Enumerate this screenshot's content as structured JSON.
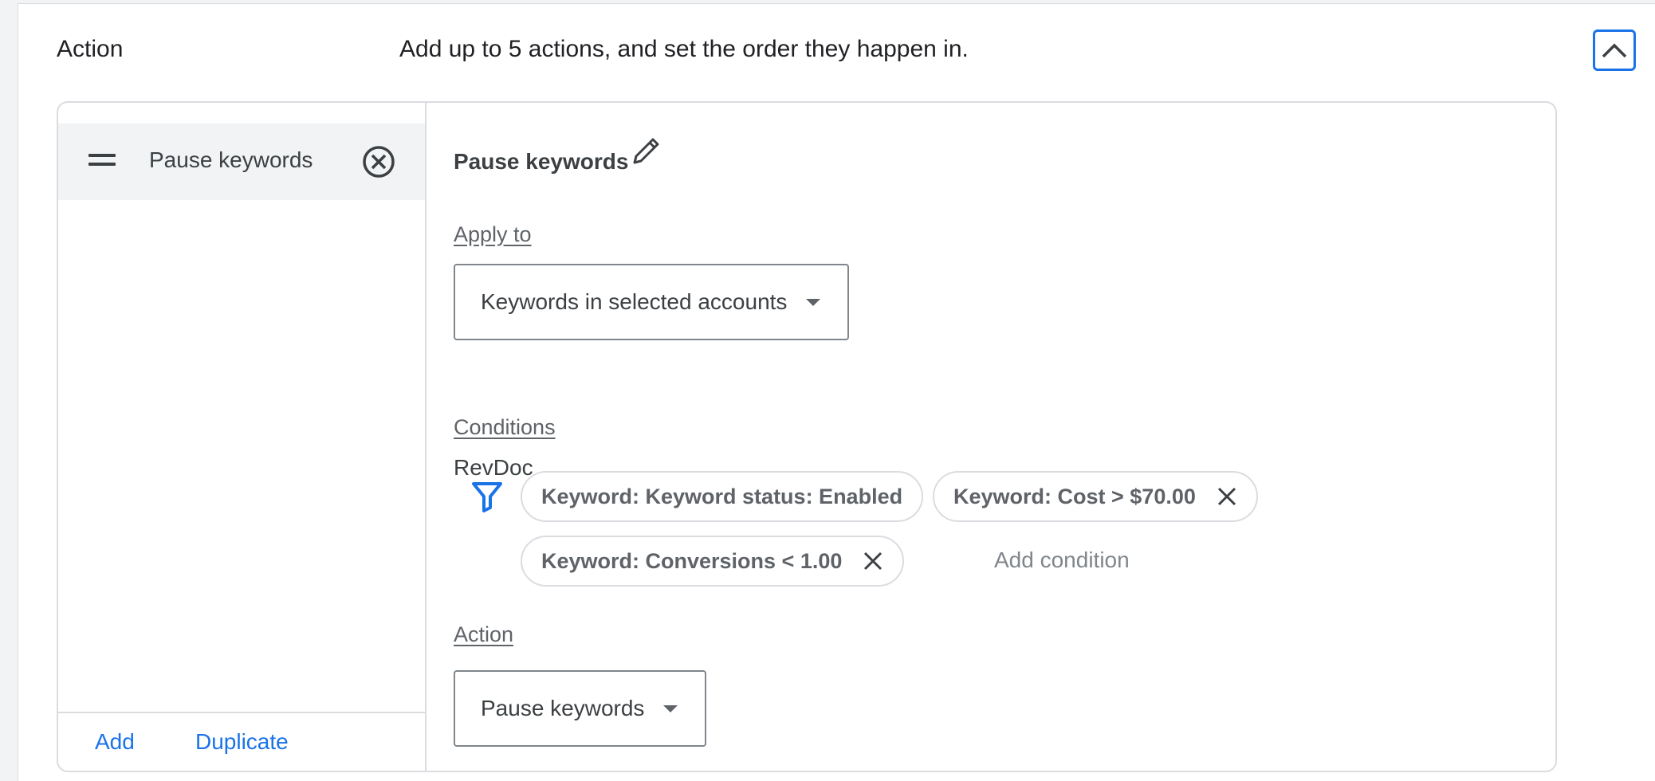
{
  "header": {
    "title": "Action",
    "description": "Add up to 5 actions, and set the order they happen in."
  },
  "action_list": {
    "items": [
      {
        "label": "Pause keywords"
      }
    ],
    "footer": {
      "add_label": "Add",
      "duplicate_label": "Duplicate"
    }
  },
  "detail": {
    "title": "Pause keywords",
    "apply_to": {
      "label": "Apply to",
      "selected": "Keywords in selected accounts",
      "account": "RevDoc"
    },
    "conditions": {
      "label": "Conditions",
      "chips": [
        "Keyword: Keyword status: Enabled",
        "Keyword: Cost > $70.00",
        "Keyword: Conversions < 1.00"
      ],
      "add_label": "Add condition"
    },
    "action": {
      "label": "Action",
      "selected": "Pause keywords"
    }
  },
  "colors": {
    "accent": "#1a73e8",
    "border": "#dadce0",
    "selected_bg": "#f1f3f4",
    "text_secondary": "#5f6368"
  },
  "icons": {
    "collapse": "chevron-up-icon",
    "drag": "drag-handle-icon",
    "remove": "remove-circle-icon",
    "edit": "pencil-icon",
    "filter": "filter-icon",
    "chip_remove": "close-icon"
  }
}
